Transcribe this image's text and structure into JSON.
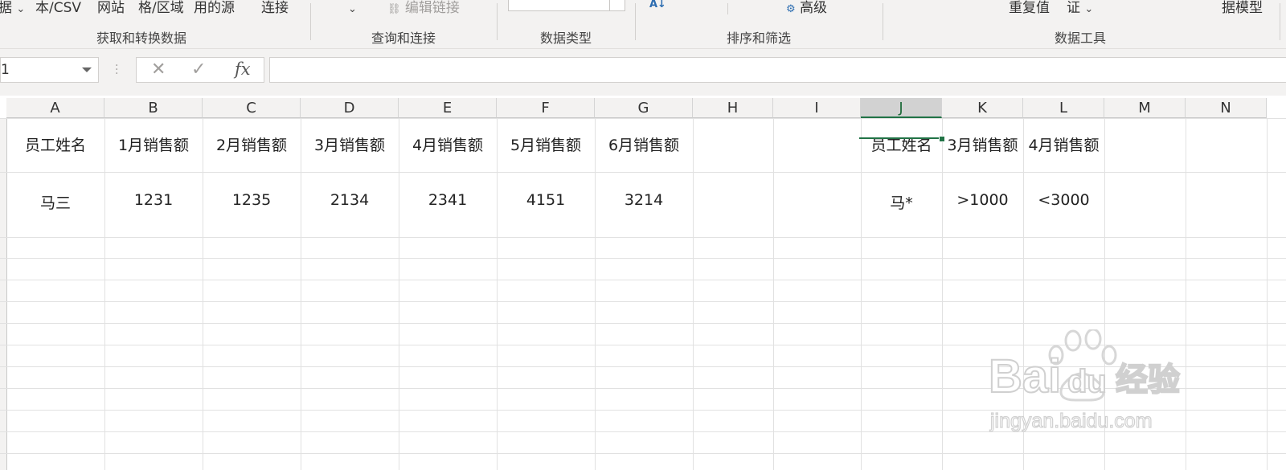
{
  "ribbon": {
    "items": [
      {
        "id": "get-data",
        "label": "据",
        "has_dropdown": true
      },
      {
        "id": "text-csv",
        "label": "本/CSV"
      },
      {
        "id": "web",
        "label": "网站"
      },
      {
        "id": "table-range",
        "label": "格/区域"
      },
      {
        "id": "recent-sources",
        "label": "用的源"
      },
      {
        "id": "connections",
        "label": "连接"
      },
      {
        "id": "edit-links",
        "label": "编辑链接",
        "disabled": true
      },
      {
        "id": "advanced",
        "label": "高级"
      },
      {
        "id": "remove-duplicates",
        "label": "重复值"
      },
      {
        "id": "data-validation",
        "label": "证",
        "has_dropdown": true
      },
      {
        "id": "data-model",
        "label": "据模型"
      }
    ],
    "groups": [
      {
        "id": "get-transform",
        "label": "获取和转换数据"
      },
      {
        "id": "queries-connections",
        "label": "查询和连接"
      },
      {
        "id": "data-types",
        "label": "数据类型"
      },
      {
        "id": "sort-filter",
        "label": "排序和筛选"
      },
      {
        "id": "data-tools",
        "label": "数据工具"
      }
    ]
  },
  "formula_bar": {
    "name_box": "1",
    "cancel_icon": "✕",
    "enter_icon": "✓",
    "fx_label": "fx",
    "formula": ""
  },
  "columns": [
    "A",
    "B",
    "C",
    "D",
    "E",
    "F",
    "G",
    "H",
    "I",
    "J",
    "K",
    "L",
    "M",
    "N"
  ],
  "selected_column": "J",
  "table": {
    "headers": [
      "员工姓名",
      "1月销售额",
      "2月销售额",
      "3月销售额",
      "4月销售额",
      "5月销售额",
      "6月销售额"
    ],
    "row": [
      "马三",
      "1231",
      "1235",
      "2134",
      "2341",
      "4151",
      "3214"
    ]
  },
  "criteria": {
    "headers": [
      "员工姓名",
      "3月销售额",
      "4月销售额"
    ],
    "row": [
      "马*",
      ">1000",
      "<3000"
    ]
  },
  "watermark": {
    "brand_left": "Bai",
    "brand_right": "du",
    "brand_cn": "经验",
    "url": "jingyan.baidu.com"
  },
  "colors": {
    "accent": "#217346",
    "ribbon_bg": "#f3f2f1",
    "gridline": "#e1e1e1"
  }
}
